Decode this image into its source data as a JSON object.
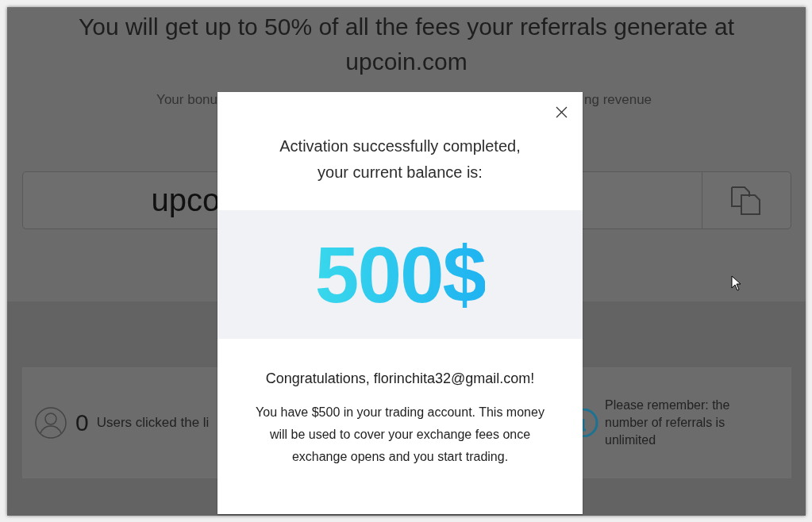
{
  "page": {
    "headline": "You will get up to 50% of all the fees your referrals generate at upcoin.com",
    "subtitle_left": "Your bonu",
    "subtitle_right": "ng revenue",
    "referral_link": "upco",
    "stats": {
      "count": "0",
      "label": "Users clicked the li"
    },
    "note": "Please remember: the number of referrals is unlimited"
  },
  "modal": {
    "title": "Activation successfully completed, your current balance is:",
    "balance": "500$",
    "greeting": "Congratulations, florinchita32@gmail.com!",
    "message": "You have $500 in your trading account. This money will be used to cover your exchange fees once exchange opens and you start trading."
  }
}
